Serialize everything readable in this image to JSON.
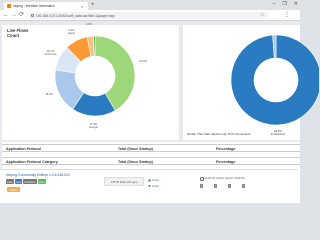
{
  "browser": {
    "tab_title": "ntopng - Interface Information",
    "tab_close": "×",
    "new_tab": "+",
    "window_controls": [
      "–",
      "❐",
      "✕"
    ],
    "back": "←",
    "forward": "→",
    "reload": "⟳",
    "url": "192.168.0.101:3000/lua/if_stats.lua?ifid=1&page=ndpi",
    "star": "☆",
    "menu": "⋮"
  },
  "left_panel": {
    "title_line1": "Live Flows",
    "title_line2": "Count",
    "chart_data": {
      "type": "pie",
      "labels": [
        "41.6%",
        "17.9%",
        "18.0%",
        "10.2%",
        "9.2%",
        "2.6%",
        "0.6%"
      ],
      "captions": [
        "",
        "Google",
        "",
        "Unknown",
        "Apple",
        "",
        ""
      ],
      "values": [
        41.6,
        17.9,
        18.0,
        10.2,
        9.2,
        2.6,
        0.6
      ],
      "colors": [
        "#9ed77a",
        "#2a7bbf",
        "#a9c8ec",
        "#d8e6f5",
        "#fb9a35",
        "#fcc083",
        "#27a22b"
      ]
    }
  },
  "right_panel": {
    "chart_data": {
      "type": "pie",
      "labels": [
        "98.8%",
        "1.2%"
      ],
      "captions": [
        "Established",
        ""
      ],
      "values": [
        98.8,
        1.2
      ],
      "colors": [
        "#2a7bbf",
        "#a9c8ec"
      ]
    },
    "note": "NOTE: This chart depicts only TCP connections."
  },
  "table": {
    "header1": {
      "col1": "Application Protocol",
      "col2": "Total (Since Startup)",
      "col3": "Percentage"
    },
    "header2": {
      "col1": "Application Protocol Category",
      "col2": "Total (Since Startup)",
      "col3": "Percentage"
    }
  },
  "footer": {
    "brand": "ntopng Community Edition v.3.8.181224",
    "badges": [
      "Live",
      "ntop",
      "Interface",
      "Host"
    ],
    "update_button": "Update",
    "sparkline_value": "178.50 kbit/s (25 pps)",
    "upload": "0 bps",
    "download": "0 bps",
    "clock": "20:32:48 +0100 | Uptime: 06:00:35",
    "pills": [
      "3",
      "1",
      "2",
      "3"
    ]
  },
  "colors": {
    "accent": "#337ab7",
    "warning": "#f0ad4e"
  }
}
